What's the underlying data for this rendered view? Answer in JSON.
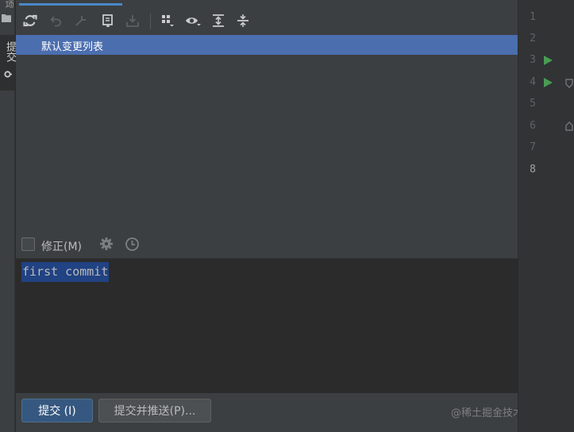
{
  "left_strip": {
    "top_label": "项",
    "commit_tab_label": "提交",
    "folder_icon": "folder-icon",
    "vcs_icon": "git-commit-icon"
  },
  "toolbar": {
    "icons": [
      "refresh-icon",
      "rollback-icon",
      "update-icon",
      "diff-icon",
      "shelve-icon",
      "group-by-icon",
      "preview-icon",
      "expand-all-icon",
      "collapse-all-icon"
    ]
  },
  "changelist": {
    "label": "默认变更列表"
  },
  "amend": {
    "label": "修正(M)",
    "checked": false,
    "gear_icon": "gear-icon",
    "history_icon": "clock-icon"
  },
  "commit_message": {
    "value": "first commit"
  },
  "buttons": {
    "commit_label": "提交 (I)",
    "commit_push_label": "提交并推送(P)..."
  },
  "watermark": "@稀土掘金技术社区",
  "editor": {
    "line_numbers": [
      "1",
      "2",
      "3",
      "4",
      "5",
      "6",
      "7",
      "8"
    ],
    "current_line": "8",
    "run_markers_on_lines": [
      "3",
      "4"
    ]
  },
  "colors": {
    "accent": "#4b6eaf",
    "selection": "#214283",
    "primary_button": "#365880",
    "run_green": "#499c54"
  }
}
